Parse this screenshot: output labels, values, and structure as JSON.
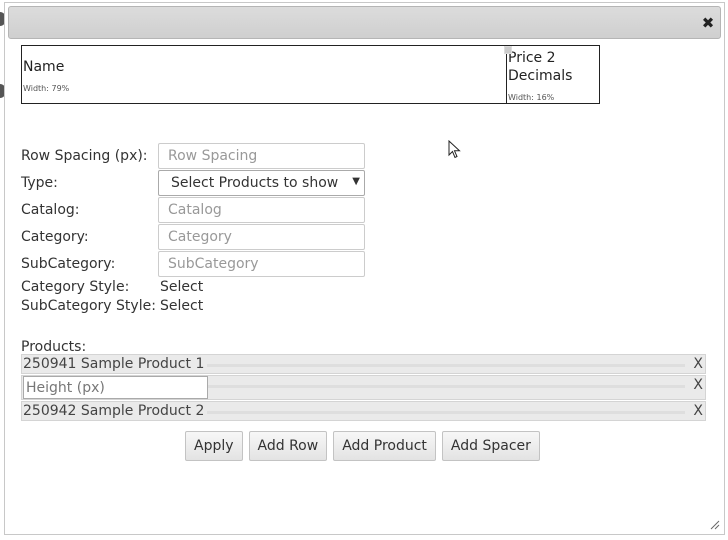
{
  "dialog": {
    "close_glyph": "✖"
  },
  "header_table": {
    "columns": [
      {
        "title": "Name",
        "width": "Width: 79%"
      },
      {
        "title": "Price 2 Decimals",
        "width": "Width: 16%"
      }
    ]
  },
  "form": {
    "row_spacing": {
      "label": "Row Spacing (px):",
      "placeholder": "Row Spacing"
    },
    "type": {
      "label": "Type:",
      "value": "Select Products to show"
    },
    "catalog": {
      "label": "Catalog:",
      "placeholder": "Catalog"
    },
    "category": {
      "label": "Category:",
      "placeholder": "Category"
    },
    "subcategory": {
      "label": "SubCategory:",
      "placeholder": "SubCategory"
    },
    "category_style": {
      "label": "Category Style:",
      "value": "Select"
    },
    "subcategory_style": {
      "label": "SubCategory Style:",
      "value": "Select"
    }
  },
  "products": {
    "label": "Products:",
    "rows": [
      {
        "text": "250941 Sample Product 1",
        "remove": "X"
      },
      {
        "height_placeholder": "Height (px)",
        "remove": "X"
      },
      {
        "text": "250942 Sample Product 2",
        "remove": "X"
      }
    ]
  },
  "buttons": {
    "apply": "Apply",
    "add_row": "Add Row",
    "add_product": "Add Product",
    "add_spacer": "Add Spacer"
  }
}
